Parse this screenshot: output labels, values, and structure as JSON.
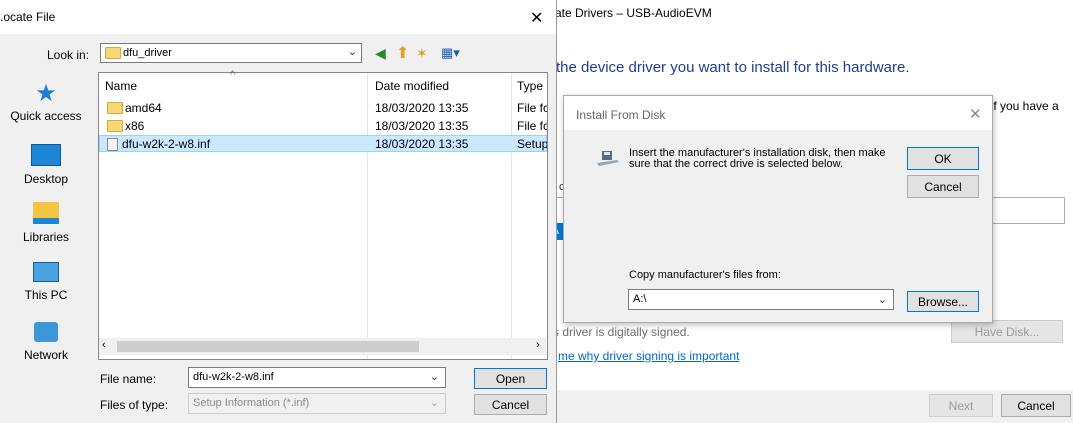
{
  "wizard": {
    "title": "ate Drivers – USB-AudioEVM",
    "heading": "the device driver you want to install for this hardware.",
    "right_text": "If you have a",
    "c_fragment": "c",
    "s_fragment": "S",
    "selected_fragment": "A",
    "signed_text": "s driver is digitally signed.",
    "signing_link": "me why driver signing is important",
    "have_disk": "Have Disk...",
    "next": "Next",
    "cancel": "Cancel"
  },
  "locate": {
    "title": ".ocate File",
    "look_in_label": "Look in:",
    "look_in_value": "dfu_driver",
    "places": [
      "Quick access",
      "Desktop",
      "Libraries",
      "This PC",
      "Network"
    ],
    "columns": [
      "Name",
      "Date modified",
      "Type"
    ],
    "files": [
      {
        "name": "amd64",
        "date": "18/03/2020 13:35",
        "type": "File fc"
      },
      {
        "name": "x86",
        "date": "18/03/2020 13:35",
        "type": "File fc"
      },
      {
        "name": "dfu-w2k-2-w8.inf",
        "date": "18/03/2020 13:35",
        "type": "Setup"
      }
    ],
    "file_name_label": "File name:",
    "file_name_value": "dfu-w2k-2-w8.inf",
    "file_type_label": "Files of type:",
    "file_type_value": "Setup Information (*.inf)",
    "open": "Open",
    "cancel": "Cancel"
  },
  "install_disk": {
    "title": "Install From Disk",
    "message": "Insert the manufacturer's installation disk, then make sure that the correct drive is selected below.",
    "ok": "OK",
    "cancel": "Cancel",
    "copy_label": "Copy manufacturer's files from:",
    "path": "A:\\",
    "browse": "Browse..."
  }
}
